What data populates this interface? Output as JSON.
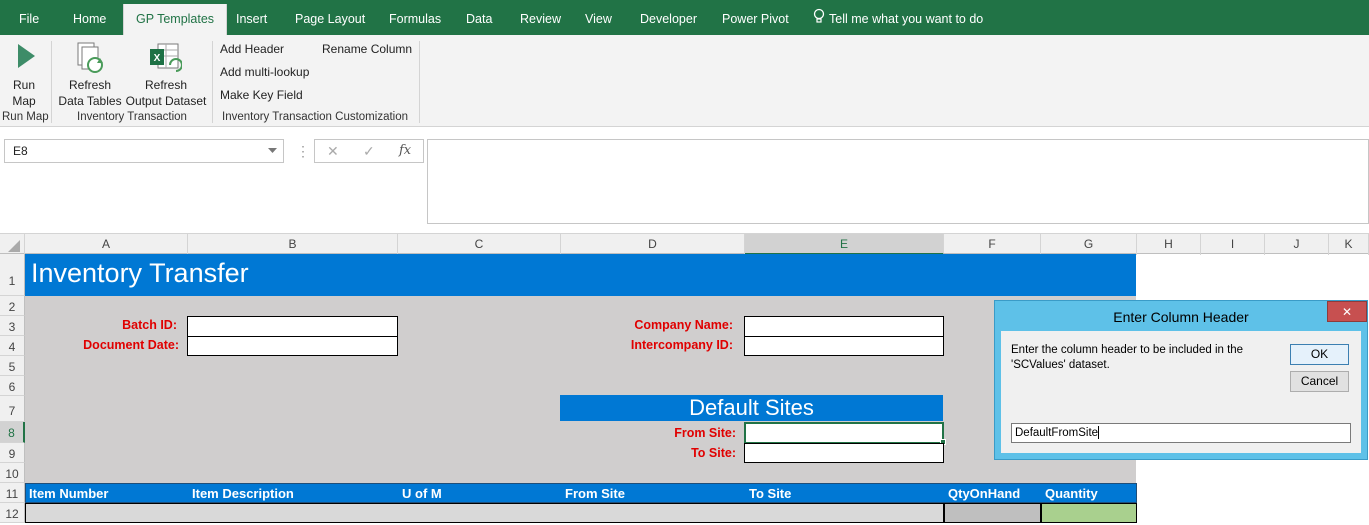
{
  "tabs": [
    {
      "label": "File"
    },
    {
      "label": "Home"
    },
    {
      "label": "GP Templates"
    },
    {
      "label": "Insert"
    },
    {
      "label": "Page Layout"
    },
    {
      "label": "Formulas"
    },
    {
      "label": "Data"
    },
    {
      "label": "Review"
    },
    {
      "label": "View"
    },
    {
      "label": "Developer"
    },
    {
      "label": "Power Pivot"
    }
  ],
  "tell_me": "Tell me what you want to do",
  "ribbon": {
    "run_map": "Run\nMap",
    "run_map_group": "Run Map",
    "refresh_tables": "Refresh\nData Tables",
    "refresh_output": "Refresh\nOutput Dataset",
    "inv_group": "Inventory Transaction",
    "add_header": "Add Header",
    "rename_column": "Rename Column",
    "add_multi_lookup": "Add multi-lookup",
    "make_key_field": "Make Key Field",
    "custom_group": "Inventory Transaction Customization"
  },
  "formula_bar": {
    "name_box": "E8",
    "fx": "fx",
    "cancel": "✕",
    "enter": "✓",
    "formula": ""
  },
  "columns": [
    "A",
    "B",
    "C",
    "D",
    "E",
    "F",
    "G",
    "H",
    "I",
    "J",
    "K"
  ],
  "rows": [
    "1",
    "2",
    "3",
    "4",
    "5",
    "6",
    "7",
    "8",
    "9",
    "10",
    "11",
    "12"
  ],
  "sheet": {
    "title": "Inventory Transfer",
    "batch_id_label": "Batch ID:",
    "document_date_label": "Document Date:",
    "company_name_label": "Company Name:",
    "intercompany_id_label": "Intercompany  ID:",
    "default_sites": "Default Sites",
    "from_site_label": "From Site:",
    "to_site_label": "To Site:",
    "table_headers": [
      "Item Number",
      "Item Description",
      "U of M",
      "From Site",
      "To Site",
      "QtyOnHand",
      "Quantity"
    ]
  },
  "dialog": {
    "title": "Enter Column Header",
    "message": "Enter the column header to be included in the 'SCValues' dataset.",
    "ok": "OK",
    "cancel": "Cancel",
    "input_value": "DefaultFromSite",
    "close": "✕"
  },
  "colors": {
    "excel_green": "#217346",
    "header_blue": "#0078d4",
    "label_red": "#e00000",
    "sheet_gray": "#d0cece",
    "dialog_blue": "#5ec1e8",
    "close_red": "#c75050",
    "quantity_green": "#a9d08e"
  }
}
